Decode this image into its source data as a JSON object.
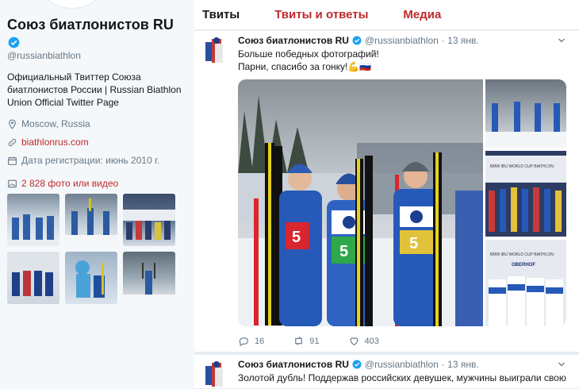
{
  "profile": {
    "name": "Союз биатлонистов RU",
    "handle": "@russianbiathlon",
    "bio": "Официальный Твиттер Союза биатлонистов России | Russian Biathlon Union Official Twitter Page",
    "location": "Moscow, Russia",
    "website": "biathlonrus.com",
    "joined": "Дата регистрации: июнь 2010 г.",
    "photos_link": "2 828 фото или видео"
  },
  "tabs": [
    "Твиты",
    "Твиты и ответы",
    "Медиа"
  ],
  "tweets": [
    {
      "name": "Союз биатлонистов RU",
      "handle": "@russianbiathlon",
      "date": "· 13 янв.",
      "line1": "Больше победных фотографий!",
      "line2": "Парни, спасибо за гонку!💪🇷🇺",
      "replies": "16",
      "retweets": "91",
      "likes": "403",
      "photo_texts": {
        "bib1": "5",
        "bib2": "5",
        "bib3": "5",
        "sponsor": "BMW",
        "venue": "OBERHOF",
        "banner": "BMW IBU WORLD CUP BIATHLON"
      }
    },
    {
      "name": "Союз биатлонистов RU",
      "handle": "@russianbiathlon",
      "date": "· 13 янв.",
      "line1": "Золотой дубль! Поддержав российских девушек, мужчины выиграли свою"
    }
  ],
  "colors": {
    "accent": "#c0282b",
    "verified": "#1da1f2",
    "muted": "#657786"
  }
}
